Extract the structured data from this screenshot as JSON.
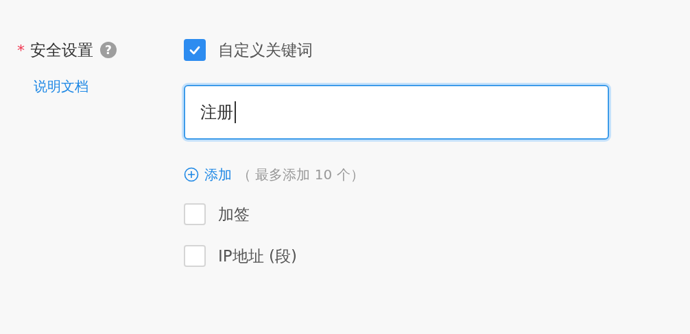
{
  "field": {
    "required_mark": "*",
    "label": "安全设置",
    "help_icon": "?",
    "doc_link": "说明文档"
  },
  "options": [
    {
      "kind": "keyword",
      "label": "自定义关键词",
      "checked": true,
      "keywords": [
        {
          "value": "注册"
        }
      ],
      "add": {
        "label": "添加",
        "hint": "（ 最多添加 10 个）"
      }
    },
    {
      "kind": "plain",
      "label": "加签",
      "checked": false
    },
    {
      "kind": "plain",
      "label": "IP地址 (段)",
      "checked": false
    }
  ]
}
